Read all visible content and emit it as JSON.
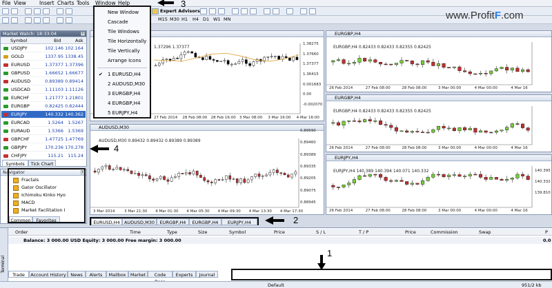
{
  "menu": [
    "File",
    "View",
    "Insert",
    "Charts",
    "Tools",
    "Window",
    "Help"
  ],
  "toolbar": {
    "expert_advisors": "Expert Advisors",
    "timeframes": [
      "M15",
      "M30",
      "H1",
      "H4",
      "D1",
      "W1",
      "MN"
    ]
  },
  "watermark": {
    "text_a": "www.Profit",
    "text_b": "F",
    "text_c": ".com"
  },
  "market_watch": {
    "title": "Market Watch: 18:33:04",
    "columns": [
      "Symbol",
      "Bid",
      "Ask"
    ],
    "rows": [
      {
        "symbol": "USDJPY",
        "bid": "102.146",
        "ask": "102.164",
        "color": "#2a9a2a"
      },
      {
        "symbol": "GOLD",
        "bid": "1337.95",
        "ask": "1338.45",
        "color": "#d4a017"
      },
      {
        "symbol": "EURUSD",
        "bid": "1.37377",
        "ask": "1.37396",
        "color": "#c23030"
      },
      {
        "symbol": "GBPUSD",
        "bid": "1.66652",
        "ask": "1.66677",
        "color": "#2a9a2a"
      },
      {
        "symbol": "AUDUSD",
        "bid": "0.89389",
        "ask": "0.89414",
        "color": "#c23030"
      },
      {
        "symbol": "USDCAD",
        "bid": "1.11103",
        "ask": "1.11126",
        "color": "#2a9a2a"
      },
      {
        "symbol": "EURCHF",
        "bid": "1.21777",
        "ask": "1.21801",
        "color": "#2a9a2a"
      },
      {
        "symbol": "EURGBP",
        "bid": "0.82425",
        "ask": "0.82444",
        "color": "#2a9a2a"
      },
      {
        "symbol": "EURJPY",
        "bid": "140.332",
        "ask": "140.362",
        "color": "#c23030"
      },
      {
        "symbol": "EURCAD",
        "bid": "1.5264",
        "ask": "1.5267",
        "color": "#2a9a2a"
      },
      {
        "symbol": "EURAUD",
        "bid": "1.5366",
        "ask": "1.5369",
        "color": "#2a9a2a"
      },
      {
        "symbol": "GBPCHF",
        "bid": "1.47725",
        "ask": "1.47769",
        "color": "#c23030"
      },
      {
        "symbol": "GBPJPY",
        "bid": "170.236",
        "ask": "170.278",
        "color": "#2a9a2a"
      },
      {
        "symbol": "CHFJPY",
        "bid": "115.21",
        "ask": "115.24",
        "color": "#c23030"
      }
    ],
    "tabs": [
      "Symbols",
      "Tick Chart"
    ]
  },
  "navigator": {
    "title": "Navigator",
    "items": [
      "Fractals",
      "Gator Oscillator",
      "Ichimoku Kinko Hyo",
      "MACD",
      "Market Facilitation I"
    ],
    "tabs": [
      "Common",
      "Favorites"
    ]
  },
  "window_menu": {
    "items": [
      "New Window",
      "Cascade",
      "Tile Windows",
      "Tile Horizontally",
      "Tile Vertically",
      "Arrange Icons"
    ],
    "windows": [
      "1 EURUSD,H4",
      "2 AUDUSD,M30",
      "3 EURGBP,H4",
      "4 EURGBP,H4",
      "5 EURJPY,H4"
    ]
  },
  "charts": {
    "eurusd": {
      "info": "1.37296 1.37377",
      "prices": [
        "1.38275",
        "1.37660",
        "1.37377",
        "1.36415",
        "0.001683",
        "0.00",
        "-0.002070"
      ],
      "dates": [
        "27 Feb 2014",
        "28 Feb 08:00",
        "28 Feb 16:00",
        "3 Mar 08:00",
        "3 Mar 16:00",
        "4 Mar 16:00"
      ]
    },
    "audusd": {
      "title": "AUDUSD,M30",
      "info": "AUDUSD,M30 0.89432 0.89432 0.89389 0.89389",
      "prices": [
        "0.89590",
        "0.89460",
        "0.89389",
        "0.89335",
        "0.89205",
        "0.89075",
        "0.88945"
      ],
      "dates": [
        "3 Mar 2014",
        "3 Mar 21:30",
        "4 Mar 01:30",
        "4 Mar 05:30",
        "4 Mar 09:30",
        "4 Mar 13:30",
        "4 Mar 17:30"
      ]
    },
    "eurgbp1": {
      "title": "EURGBP,H4",
      "info": "EURGBP,H4 0.82433 0.82433 0.82355 0.82425",
      "dates": [
        "26 Feb 2014",
        "27 Feb 08:00",
        "28 Feb 08:00",
        "3 Mar 00:00",
        "4 Mar 00:00",
        "4 Mar 16"
      ]
    },
    "eurgbp2": {
      "title": "EURGBP,H4",
      "info": "EURGBP,H4 0.82433 0.82433 0.82355 0.82425",
      "dates": [
        "26 Feb 2014",
        "27 Feb 08:00",
        "28 Feb 08:00",
        "3 Mar 00:00",
        "4 Mar 00:00",
        "4 Mar 16"
      ]
    },
    "eurjpy": {
      "title": "EURJPY,H4",
      "info": "EURJPY,H4 140.389 140.394 140.071 140.332",
      "prices": [
        "140.395",
        "140.332",
        "139.810"
      ],
      "dates": [
        "26 Feb 2014",
        "27 Feb 08:00",
        "28 Feb 08:00",
        "3 Mar 00:00",
        "4 Mar 00:00",
        "4 Mar 16"
      ]
    }
  },
  "chart_tabs": [
    "EURUSD,H4",
    "AUDUSD,M30",
    "EURGBP,H4",
    "EURGBP,H4",
    "EURJPY,H4"
  ],
  "terminal": {
    "columns": [
      "Order",
      "Time",
      "Type",
      "Size",
      "Symbol",
      "Price",
      "S / L",
      "T / P",
      "Price",
      "Commission",
      "Swap",
      "P"
    ],
    "balance": "Balance: 3 000.00 USD  Equity: 3 000.00  Free margin: 3 000.00",
    "balance_right": "0.0",
    "tabs": [
      "Trade",
      "Account History",
      "News",
      "Alerts",
      "Mailbox",
      "Market",
      "Code Base",
      "Experts",
      "Journal"
    ],
    "side_label": "Terminal"
  },
  "status": {
    "profile": "Default",
    "traffic": "951/2 kb"
  },
  "annotations": [
    "1",
    "2",
    "3",
    "4"
  ]
}
